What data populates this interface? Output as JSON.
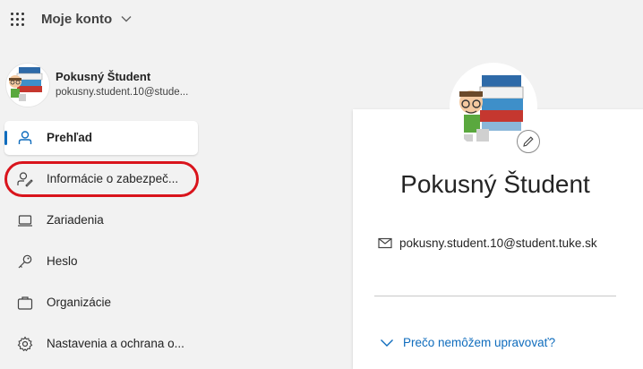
{
  "header": {
    "app_title": "Moje konto",
    "app_launcher_icon": "waffle-icon",
    "dropdown_icon": "chevron-down-icon"
  },
  "profile": {
    "name": "Pokusný Študent",
    "email": "pokusny.student.10@stude..."
  },
  "nav": {
    "items": [
      {
        "label": "Prehľad",
        "icon": "person-icon",
        "active": true
      },
      {
        "label": "Informácie o zabezpeč...",
        "icon": "security-info-icon",
        "active": false
      },
      {
        "label": "Zariadenia",
        "icon": "laptop-icon",
        "active": false
      },
      {
        "label": "Heslo",
        "icon": "key-icon",
        "active": false
      },
      {
        "label": "Organizácie",
        "icon": "briefcase-icon",
        "active": false
      },
      {
        "label": "Nastavenia a ochrana o...",
        "icon": "gear-icon",
        "active": false
      }
    ]
  },
  "card": {
    "name": "Pokusný Študent",
    "email": "pokusny.student.10@student.tuke.sk",
    "why_link": "Prečo nemôžem upravovať?"
  },
  "colors": {
    "accent": "#0f6cbd",
    "highlight": "#d9141c",
    "background": "#f2f2f2"
  }
}
